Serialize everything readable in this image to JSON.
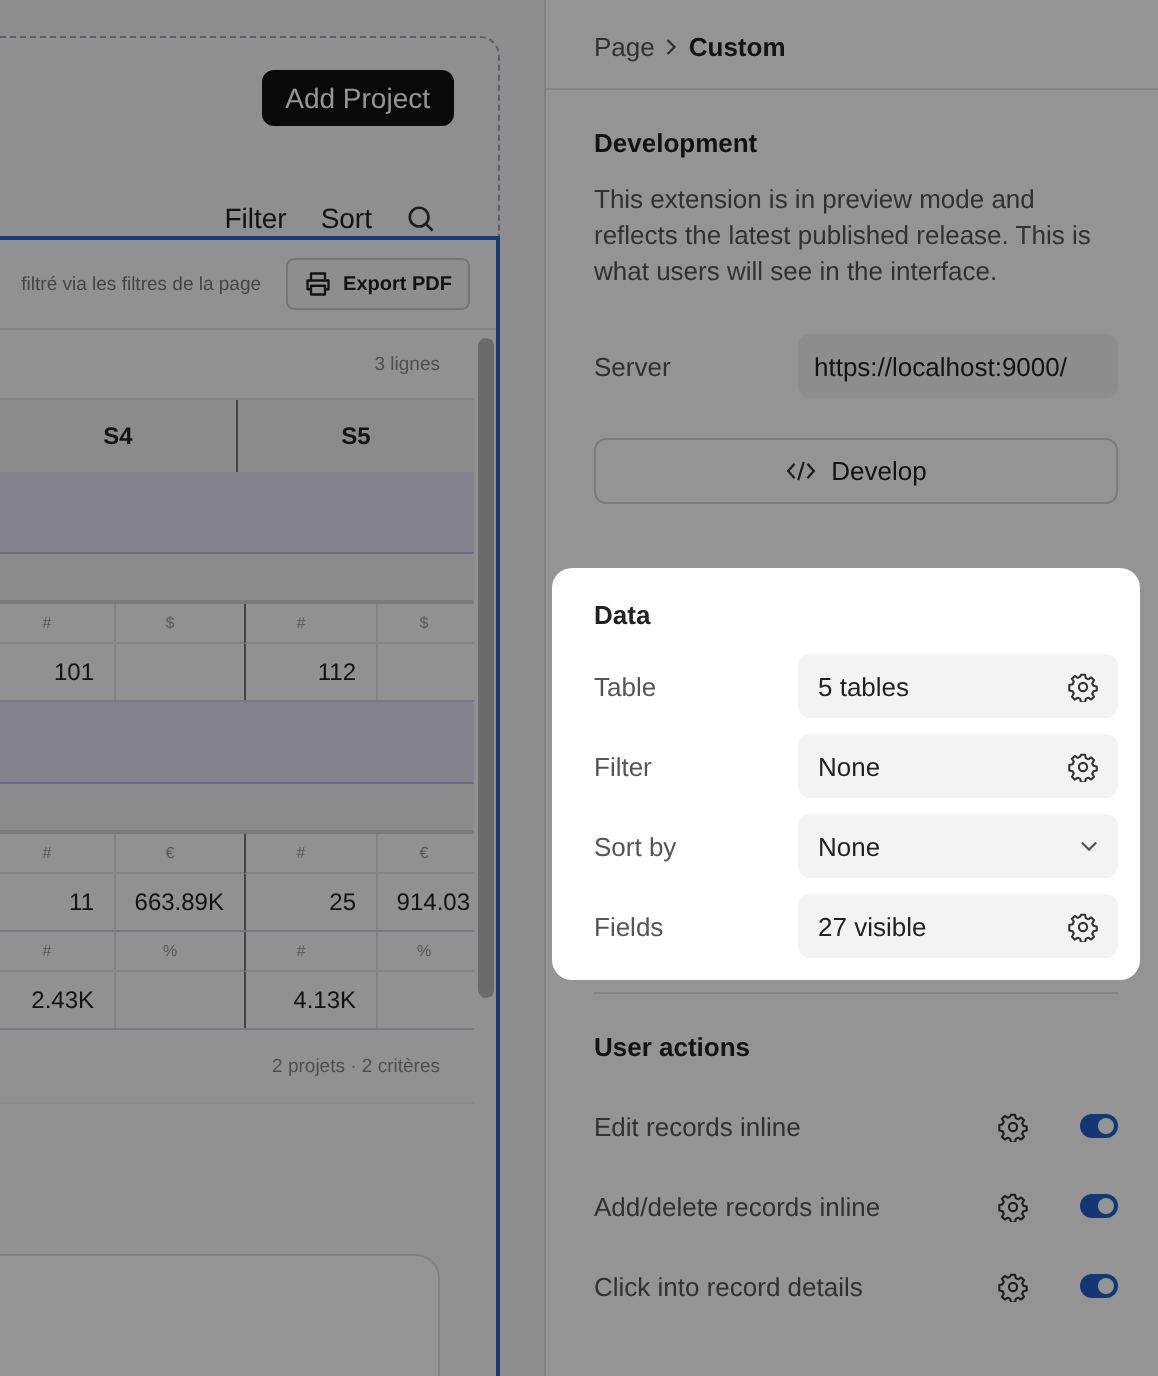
{
  "canvas": {
    "add_button": "Add Project",
    "actions": [
      "Filter",
      "Sort"
    ]
  },
  "table": {
    "filter_note": "filtré via les filtres de la page",
    "export_button": "Export PDF",
    "row_count": "3 lignes",
    "columns": [
      "S4",
      "S5"
    ],
    "groups": [
      {
        "blocks": [
          {
            "cells": [
              {
                "unit": "#",
                "value": "101"
              },
              {
                "unit": "$"
              },
              {
                "unit": "#",
                "value": "112"
              },
              {
                "unit": "$"
              }
            ]
          }
        ]
      },
      {
        "blocks": [
          {
            "cells": [
              {
                "unit": "#",
                "value": "11"
              },
              {
                "unit": "€",
                "value": "663.89K"
              },
              {
                "unit": "#",
                "value": "25"
              },
              {
                "unit": "€",
                "value": "914.03"
              }
            ]
          },
          {
            "cells": [
              {
                "unit": "#",
                "value": "2.43K"
              },
              {
                "unit": "%"
              },
              {
                "unit": "#",
                "value": "4.13K"
              },
              {
                "unit": "%"
              }
            ]
          }
        ]
      }
    ],
    "footer": "2 projets · 2 critères"
  },
  "panel": {
    "breadcrumb": {
      "parent": "Page",
      "current": "Custom"
    },
    "development": {
      "title": "Development",
      "description": "This extension is in preview mode and reflects the latest published release. This is what users will see in the interface.",
      "server_label": "Server",
      "server_value": "https://localhost:9000/",
      "button": "Develop"
    },
    "data": {
      "title": "Data",
      "rows": [
        {
          "label": "Table",
          "value": "5 tables",
          "kind": "settings"
        },
        {
          "label": "Filter",
          "value": "None",
          "kind": "settings"
        },
        {
          "label": "Sort by",
          "value": "None",
          "kind": "dropdown"
        },
        {
          "label": "Fields",
          "value": "27 visible",
          "kind": "settings"
        }
      ]
    },
    "user_actions": {
      "title": "User actions",
      "rows": [
        {
          "label": "Edit records inline",
          "on": true
        },
        {
          "label": "Add/delete records inline",
          "on": true
        },
        {
          "label": "Click into record details",
          "on": true
        }
      ]
    }
  }
}
